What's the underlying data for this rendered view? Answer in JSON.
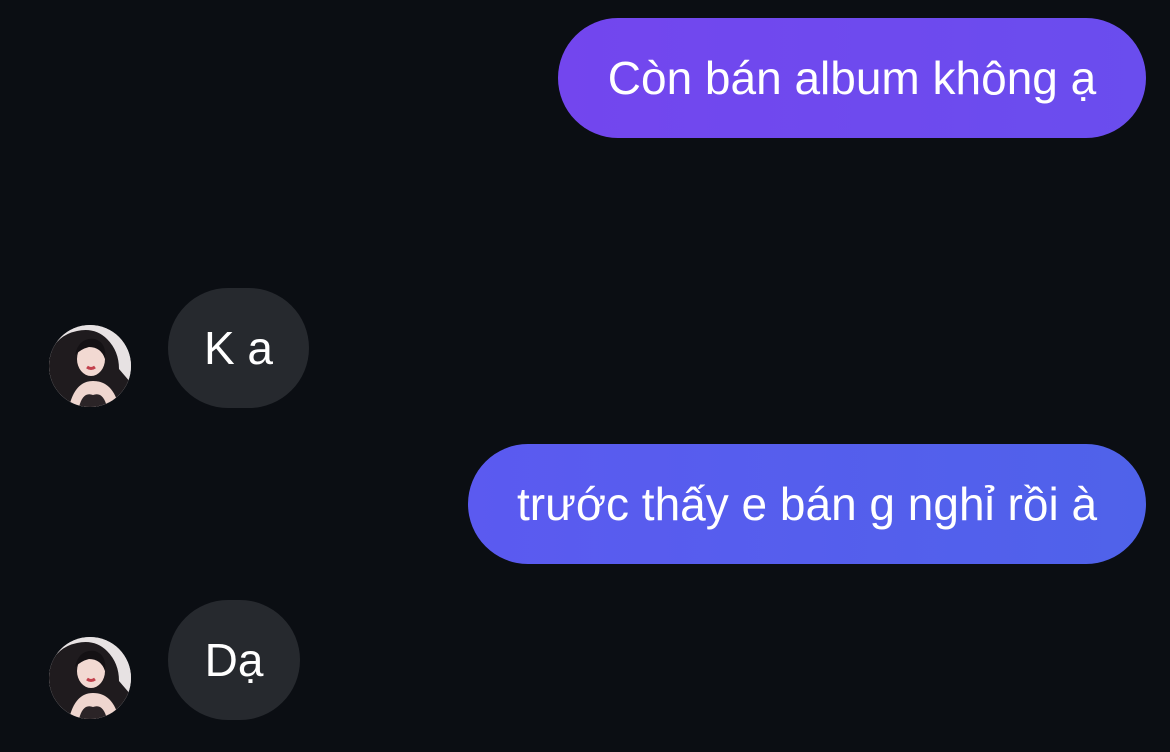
{
  "messages": [
    {
      "direction": "outgoing",
      "text": "Còn bán album không ạ"
    },
    {
      "direction": "incoming",
      "text": "K a",
      "has_avatar": true
    },
    {
      "direction": "outgoing",
      "text": "trước thấy e bán g nghỉ rồi à"
    },
    {
      "direction": "incoming",
      "text": "Dạ",
      "has_avatar": true
    }
  ],
  "colors": {
    "background": "#0b0e13",
    "outgoing_bubble_top": "#7346ee",
    "outgoing_bubble_bottom": "#5060ea",
    "incoming_bubble": "#26292e",
    "text": "#ffffff"
  },
  "icons": {
    "avatar": "contact-profile-photo"
  }
}
